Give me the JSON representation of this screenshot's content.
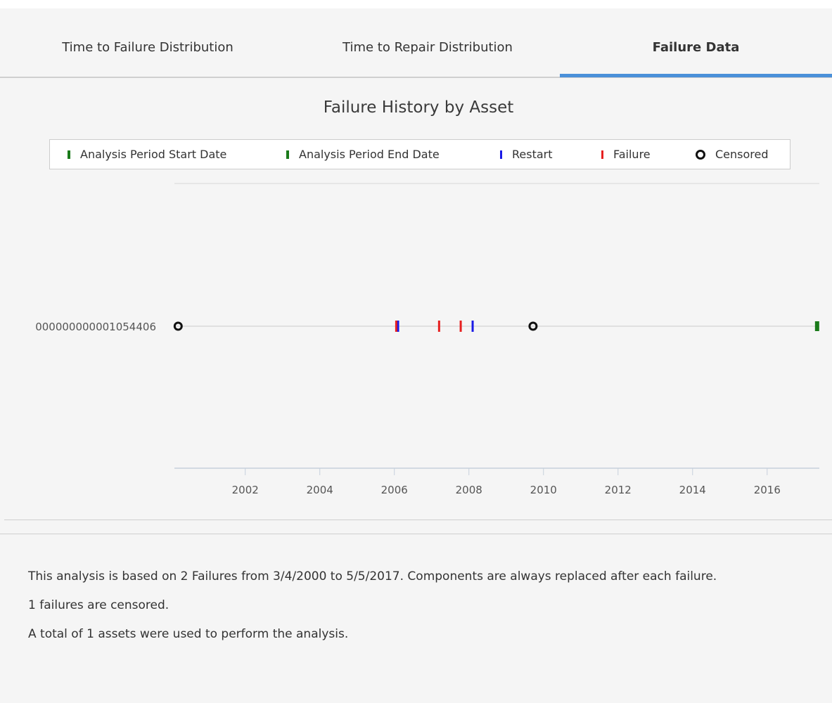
{
  "tabs": [
    {
      "label": "Time to Failure Distribution",
      "active": false
    },
    {
      "label": "Time to Repair Distribution",
      "active": false
    },
    {
      "label": "Failure Data",
      "active": true
    }
  ],
  "colors": {
    "accent": "#4a90d9",
    "start_date": "#1a7a1a",
    "end_date": "#1a7a1a",
    "restart": "#1a1ae6",
    "failure": "#e62020",
    "censored": "#111111"
  },
  "chart_data": {
    "type": "scatter",
    "title": "Failure History by Asset",
    "legend": [
      {
        "label": "Analysis Period Start Date",
        "marker": "green-bar"
      },
      {
        "label": "Analysis Period End Date",
        "marker": "green-bar"
      },
      {
        "label": "Restart",
        "marker": "blue-tick"
      },
      {
        "label": "Failure",
        "marker": "red-tick"
      },
      {
        "label": "Censored",
        "marker": "open-circle"
      }
    ],
    "legend_position": "top",
    "categories": [
      "000000000001054406"
    ],
    "xlim": [
      2000.1,
      2017.4
    ],
    "x_ticks": [
      "2002",
      "2004",
      "2006",
      "2008",
      "2010",
      "2012",
      "2014",
      "2016"
    ],
    "x_tick_values": [
      2002,
      2004,
      2006,
      2008,
      2010,
      2012,
      2014,
      2016
    ],
    "series": [
      {
        "name": "Analysis Period End Date",
        "asset": "000000000001054406",
        "x": [
          2017.34
        ]
      },
      {
        "name": "Restart",
        "asset": "000000000001054406",
        "x": [
          2006.1,
          2008.1
        ]
      },
      {
        "name": "Failure",
        "asset": "000000000001054406",
        "x": [
          2006.05,
          2007.2,
          2007.78
        ]
      },
      {
        "name": "Censored",
        "asset": "000000000001054406",
        "x": [
          2000.2,
          2009.72
        ]
      }
    ]
  },
  "summary": {
    "line1": "This analysis is based on   2   Failures from 3/4/2000 to 5/5/2017.  Components are   always   replaced after each failure.",
    "line2": "1   failures are censored.",
    "line3": "A total of   1   assets were used to perform the analysis."
  }
}
